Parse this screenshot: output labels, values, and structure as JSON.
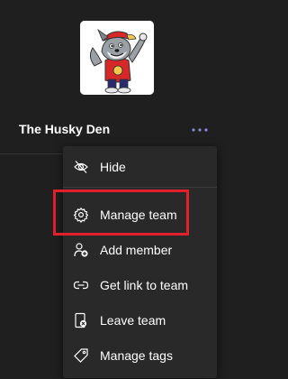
{
  "team": {
    "name": "The Husky Den",
    "more_icon": "ellipsis-icon"
  },
  "menu": {
    "items": [
      {
        "label": "Hide",
        "icon": "eye-off-icon"
      },
      {
        "label": "Manage team",
        "icon": "gear-icon"
      },
      {
        "label": "Add member",
        "icon": "add-person-icon"
      },
      {
        "label": "Get link to team",
        "icon": "link-icon"
      },
      {
        "label": "Leave team",
        "icon": "leave-door-icon"
      },
      {
        "label": "Manage tags",
        "icon": "tag-icon"
      }
    ]
  },
  "colors": {
    "background": "#1f1f1f",
    "menu_background": "#292929",
    "accent": "#6264a7",
    "highlight": "#e0202a"
  }
}
